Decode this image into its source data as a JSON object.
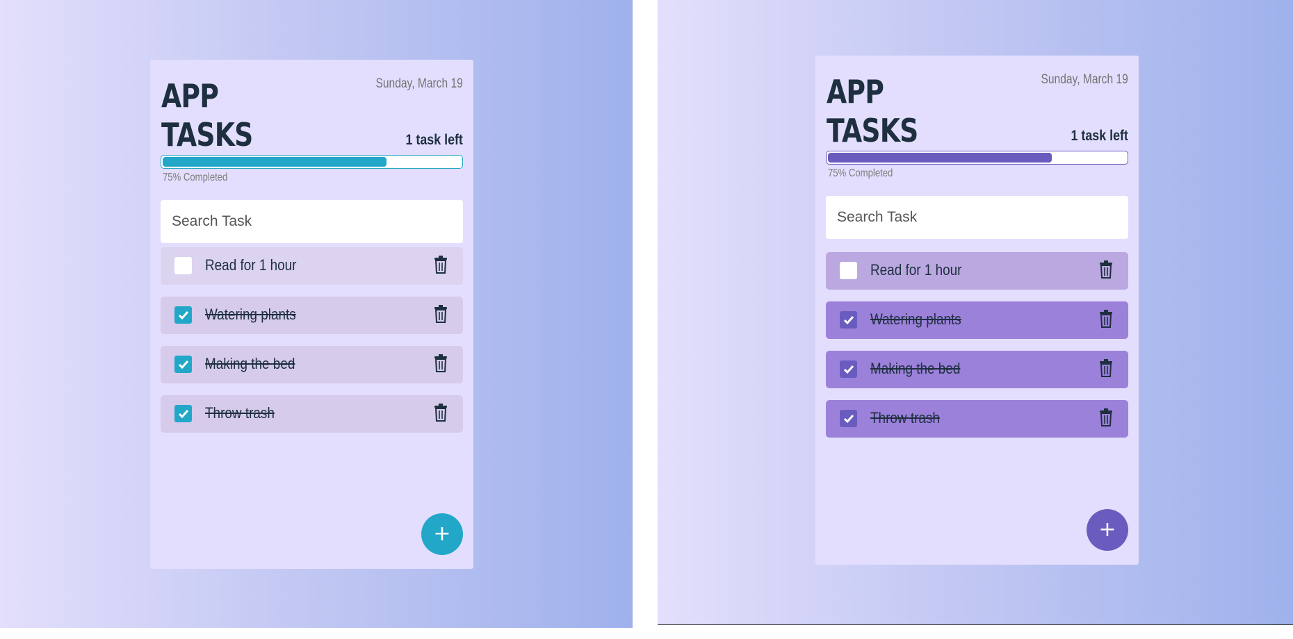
{
  "views": [
    {
      "title_line1": "APP",
      "title_line2": "TASKS",
      "date": "Sunday, March 19",
      "tasks_left": "1 task left",
      "progress_fraction": 0.75,
      "progress_label": "75% Completed",
      "search_placeholder": "Search Task",
      "accent_color": "#22a7c9",
      "task_bg_open": "#dcd3ef",
      "task_bg_done": "#d6cbea",
      "tasks": [
        {
          "label": "Read for 1 hour",
          "done": false
        },
        {
          "label": "Watering plants",
          "done": true
        },
        {
          "label": "Making the bed",
          "done": true
        },
        {
          "label": "Throw trash",
          "done": true
        }
      ],
      "add_button_label": "+"
    },
    {
      "title_line1": "APP",
      "title_line2": "TASKS",
      "date": "Sunday, March 19",
      "tasks_left": "1 task left",
      "progress_fraction": 0.75,
      "progress_label": "75% Completed",
      "search_placeholder": "Search Task",
      "accent_color": "#6a5cbf",
      "task_bg_open": "#bba8e0",
      "task_bg_done": "#9b81da",
      "tasks": [
        {
          "label": "Read for 1 hour",
          "done": false
        },
        {
          "label": "Watering plants",
          "done": true
        },
        {
          "label": "Making the bed",
          "done": true
        },
        {
          "label": "Throw trash",
          "done": true
        }
      ],
      "add_button_label": "+"
    }
  ]
}
